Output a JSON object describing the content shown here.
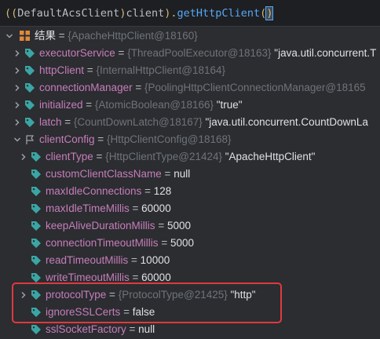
{
  "expression": {
    "open_parens": "((",
    "class_name": "DefaultAcsClient",
    "close_paren": ")",
    "variable": " client",
    "close_paren2": ").",
    "method": "getHttpClient",
    "call_open": "(",
    "call_close": ")"
  },
  "tree": {
    "root": {
      "label": "结果",
      "eq": " = ",
      "ref": "{ApacheHttpClient@18160}"
    },
    "fields": [
      {
        "name": "executorService",
        "ref": "{ThreadPoolExecutor@18163}",
        "value": " \"java.util.concurrent.T"
      },
      {
        "name": "httpClient",
        "ref": "{InternalHttpClient@18164}",
        "value": ""
      },
      {
        "name": "connectionManager",
        "ref": "{PoolingHttpClientConnectionManager@18165",
        "value": ""
      },
      {
        "name": "initialized",
        "ref": "{AtomicBoolean@18166}",
        "value": " \"true\""
      },
      {
        "name": "latch",
        "ref": "{CountDownLatch@18167}",
        "value": " \"java.util.concurrent.CountDownLa"
      }
    ],
    "client_config": {
      "name": "clientConfig",
      "ref": "{HttpClientConfig@18168}",
      "children": [
        {
          "name": "clientType",
          "ref": "{HttpClientType@21424}",
          "value": " \"ApacheHttpClient\"",
          "expandable": true
        },
        {
          "name": "customClientClassName",
          "ref": "",
          "value": "null",
          "expandable": false
        },
        {
          "name": "maxIdleConnections",
          "ref": "",
          "value": "128",
          "expandable": false
        },
        {
          "name": "maxIdleTimeMillis",
          "ref": "",
          "value": "60000",
          "expandable": false
        },
        {
          "name": "keepAliveDurationMillis",
          "ref": "",
          "value": "5000",
          "expandable": false
        },
        {
          "name": "connectionTimeoutMillis",
          "ref": "",
          "value": "5000",
          "expandable": false
        },
        {
          "name": "readTimeoutMillis",
          "ref": "",
          "value": "10000",
          "expandable": false
        },
        {
          "name": "writeTimeoutMillis",
          "ref": "",
          "value": "60000",
          "expandable": false
        },
        {
          "name": "protocolType",
          "ref": "{ProtocolType@21425}",
          "value": " \"http\"",
          "expandable": true
        },
        {
          "name": "ignoreSSLCerts",
          "ref": "",
          "value": "false",
          "expandable": false
        },
        {
          "name": "sslSocketFactory",
          "ref": "",
          "value": "null",
          "expandable": false
        }
      ]
    }
  },
  "colors": {
    "background": "#2b2d30",
    "field_name": "#c77dbb",
    "reference": "#6f737a",
    "tag_icon": "#3ba5a5",
    "highlight_box": "#e0393e",
    "method": "#56a8f5"
  },
  "icons": {
    "expand": "chevron-right-icon",
    "collapse": "chevron-down-icon",
    "field": "tag-icon",
    "result": "grid-result-icon",
    "config": "flag-icon"
  }
}
